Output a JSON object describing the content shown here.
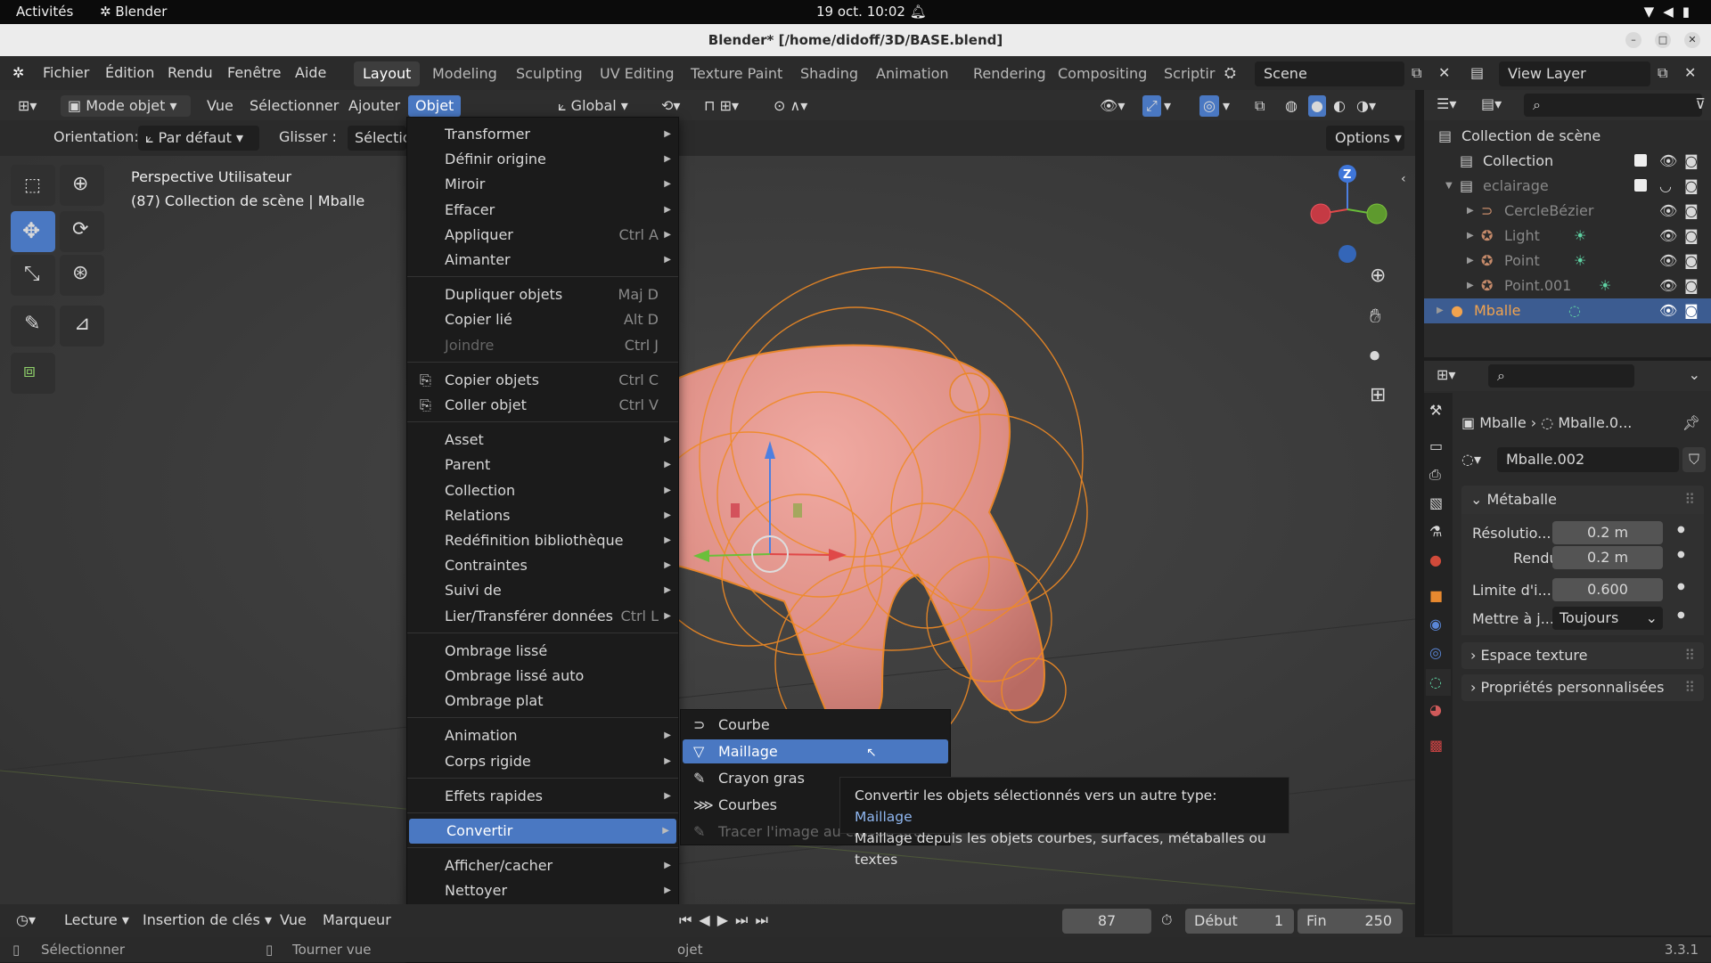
{
  "gnome": {
    "activities": "Activités",
    "app": "Blender",
    "clock": "19 oct.  10:02"
  },
  "window": {
    "title": "Blender* [/home/didoff/3D/BASE.blend]"
  },
  "menubar": {
    "items": [
      "Fichier",
      "Édition",
      "Rendu",
      "Fenêtre",
      "Aide"
    ]
  },
  "workspaces": [
    "Layout",
    "Modeling",
    "Sculpting",
    "UV Editing",
    "Texture Paint",
    "Shading",
    "Animation",
    "Rendering",
    "Compositing",
    "Scriptir"
  ],
  "scene": {
    "name": "Scene"
  },
  "viewlayer": {
    "name": "View Layer"
  },
  "header": {
    "mode": "Mode objet",
    "vue": "Vue",
    "selectionner": "Sélectionner",
    "ajouter": "Ajouter",
    "objet": "Objet",
    "transform": "Global",
    "orientation_label": "Orientation:",
    "orientation_value": "Par défaut",
    "glisser": "Glisser :",
    "selectio": "Sélectio",
    "options": "Options"
  },
  "viewport": {
    "line1": "Perspective Utilisateur",
    "line2": "(87) Collection de scène | Mballe"
  },
  "menu": [
    {
      "label": "Transformer",
      "shortcut": "",
      "arrow": true
    },
    {
      "label": "Définir origine",
      "shortcut": "",
      "arrow": true
    },
    {
      "label": "Miroir",
      "shortcut": "",
      "arrow": true
    },
    {
      "label": "Effacer",
      "shortcut": "",
      "arrow": true
    },
    {
      "label": "Appliquer",
      "shortcut": "Ctrl A",
      "arrow": true
    },
    {
      "label": "Aimanter",
      "shortcut": "",
      "arrow": true
    },
    {
      "label": "Dupliquer objets",
      "shortcut": "Maj D",
      "arrow": false
    },
    {
      "label": "Copier lié",
      "shortcut": "Alt D",
      "arrow": false
    },
    {
      "label": "Joindre",
      "shortcut": "Ctrl J",
      "arrow": false
    },
    {
      "label": "Copier objets",
      "shortcut": "Ctrl C",
      "arrow": false
    },
    {
      "label": "Coller objet",
      "shortcut": "Ctrl V",
      "arrow": false
    },
    {
      "label": "Asset",
      "shortcut": "",
      "arrow": true
    },
    {
      "label": "Parent",
      "shortcut": "",
      "arrow": true
    },
    {
      "label": "Collection",
      "shortcut": "",
      "arrow": true
    },
    {
      "label": "Relations",
      "shortcut": "",
      "arrow": true
    },
    {
      "label": "Redéfinition bibliothèque",
      "shortcut": "",
      "arrow": true
    },
    {
      "label": "Contraintes",
      "shortcut": "",
      "arrow": true
    },
    {
      "label": "Suivi de",
      "shortcut": "",
      "arrow": true
    },
    {
      "label": "Lier/Transférer données",
      "shortcut": "Ctrl L",
      "arrow": true
    },
    {
      "label": "Ombrage lissé",
      "shortcut": "",
      "arrow": false
    },
    {
      "label": "Ombrage lissé auto",
      "shortcut": "",
      "arrow": false
    },
    {
      "label": "Ombrage plat",
      "shortcut": "",
      "arrow": false
    },
    {
      "label": "Animation",
      "shortcut": "",
      "arrow": true
    },
    {
      "label": "Corps rigide",
      "shortcut": "",
      "arrow": true
    },
    {
      "label": "Effets rapides",
      "shortcut": "",
      "arrow": true
    },
    {
      "label": "Convertir",
      "shortcut": "",
      "arrow": true
    },
    {
      "label": "Afficher/cacher",
      "shortcut": "",
      "arrow": true
    },
    {
      "label": "Nettoyer",
      "shortcut": "",
      "arrow": true
    }
  ],
  "submenu": [
    {
      "label": "Courbe"
    },
    {
      "label": "Maillage"
    },
    {
      "label": "Crayon gras"
    },
    {
      "label": "Courbes"
    },
    {
      "label": "Tracer l'image au crayon gras"
    }
  ],
  "tooltip": {
    "line1": "Convertir les objets sélectionnés vers un autre type:",
    "target": "Maillage",
    "line2": "Maillage depuis les objets courbes, surfaces, métaballes ou textes"
  },
  "outliner": {
    "rows": [
      {
        "name": "Collection de scène"
      },
      {
        "name": "Collection"
      },
      {
        "name": "eclairage"
      },
      {
        "name": "CercleBézier"
      },
      {
        "name": "Light"
      },
      {
        "name": "Point"
      },
      {
        "name": "Point.001"
      },
      {
        "name": "Mballe"
      }
    ]
  },
  "properties": {
    "crumb_object": "Mballe",
    "crumb_data": "Mballe.0...",
    "datablock": "Mballe.002",
    "section": "Métaballe",
    "fields": [
      {
        "label": "Résolutio...",
        "value": "0.2 m"
      },
      {
        "label": "Rendu",
        "value": "0.2 m"
      },
      {
        "label": "Limite d'i...",
        "value": "0.600"
      },
      {
        "label": "Mettre à j...",
        "value": "Toujours"
      }
    ],
    "subpanels": [
      "Espace texture",
      "Propriétés personnalisées"
    ]
  },
  "timeline": {
    "lecture": "Lecture",
    "insertion": "Insertion de clés",
    "vue": "Vue",
    "marqueur": "Marqueur",
    "frame": "87",
    "debut_label": "Début",
    "debut": "1",
    "fin_label": "Fin",
    "fin": "250"
  },
  "status": {
    "select": "Sélectionner",
    "rotate": "Tourner vue",
    "objet": "ojet",
    "version": "3.3.1"
  },
  "colors": {
    "accent": "#4a78c2",
    "selection_orange": "#f08a24",
    "blob": "#e59a92"
  }
}
